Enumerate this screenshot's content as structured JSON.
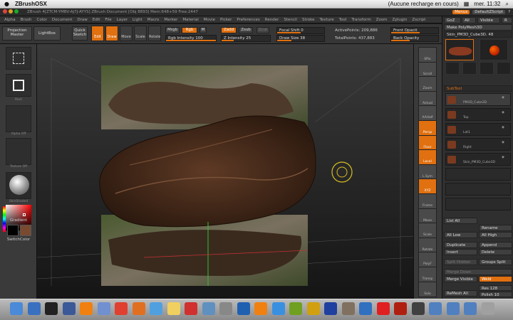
{
  "mac_menu": {
    "app_name": "ZBrushOSX",
    "time": "mer. 11:32",
    "recharge": "(Aucune recharge en cours)"
  },
  "titlebar": {
    "title": "ZBrush 4[ZTCM-YMBV-AJ7J-AYYS]   ZBrush Document   [Obj 8893]  Mem:648+59  Free:2447",
    "menus_btn": "Menus",
    "script": "DefaultZScript"
  },
  "menus": [
    "Alpha",
    "Brush",
    "Color",
    "Document",
    "Draw",
    "Edit",
    "File",
    "Layer",
    "Light",
    "Macro",
    "Marker",
    "Material",
    "Movie",
    "Picker",
    "Preferences",
    "Render",
    "Stencil",
    "Stroke",
    "Texture",
    "Tool",
    "Transform",
    "Zoom",
    "Zplugin",
    "Zscript"
  ],
  "toolbar": {
    "projection_master": "Projection Master",
    "lightbox": "LightBox",
    "quick_sketch": "Quick Sketch",
    "edit": "Edit",
    "draw": "Draw",
    "move": "Move",
    "scale": "Scale",
    "rotate": "Rotate",
    "mrgb": "Mrgb",
    "rgb": "Rgb",
    "m": "M",
    "rgb_intensity": "Rgb Intensity 100",
    "zadd": "Zadd",
    "zsub": "Zsub",
    "zcut": "Zcut",
    "z_intensity": "Z Intensity 25",
    "focal_shift": "Focal Shift 0",
    "draw_size": "Draw Size 38",
    "active_points": "ActivePoints: 209,886",
    "total_points": "TotalPoints: 437,883",
    "front_opacity": "Front Opacit",
    "back_opacity": "Back Opacity"
  },
  "left_shelf": {
    "labels": [
      "Rect",
      "Alpha Off",
      "Texture Off",
      "SkinShade4"
    ],
    "gradient": "Gradient",
    "switch_color": "SwitchColor"
  },
  "right_shelf": [
    "SPix",
    "Scroll",
    "Zoom",
    "Actual",
    "AAHalf",
    "Persp",
    "Floor",
    "Local",
    "L.Sym",
    "XYZ",
    "Frame",
    "Move",
    "Scale",
    "Rotate",
    "PolyF",
    "Transp",
    "Solo"
  ],
  "tray": {
    "tabs": [
      "GoZ",
      "All",
      "Visible",
      "R"
    ],
    "make_polymesh": "Make PolyMesh3D",
    "tool_name": "Skin_PM3D_Cube3D. 48",
    "tool_labels": [
      "Skin_PM3D_Cub",
      "Sphere3D",
      "ZSphere",
      "SimpleBrush",
      "Skin_PM3D_Cub",
      "Skin_PM3D_Cub"
    ],
    "subtool_header": "SubTool",
    "subtools": [
      "PM3D_Cube3D",
      "Top",
      "Lat1",
      "Right",
      "Skin_PM3D_Cube3D"
    ],
    "list_all": "List All",
    "rename": "Rename",
    "all_low": "All Low",
    "all_high": "All High",
    "duplicate": "Duplicate",
    "append": "Append",
    "insert": "Insert",
    "delete": "Delete",
    "split_hidden": "Split Hidden",
    "groups_split": "Groups Split",
    "merge_down": "Merge Down",
    "merge_visible": "Merge Visible",
    "weld": "Weld",
    "remesh_all": "ReMesh All",
    "res": "Res 128",
    "polish": "Polish 10"
  },
  "dock_icons": [
    "finder",
    "mail",
    "terminal",
    "fb",
    "vlc",
    "preview",
    "chrome",
    "firefox",
    "itunes",
    "notes",
    "calendar",
    "photos",
    "system",
    "quicktime",
    "vlc2",
    "safari",
    "transmit",
    "app",
    "app2",
    "gimp",
    "xcode",
    "app3",
    "filezilla",
    "app4",
    "folder",
    "folder2",
    "downloads",
    "trash"
  ]
}
